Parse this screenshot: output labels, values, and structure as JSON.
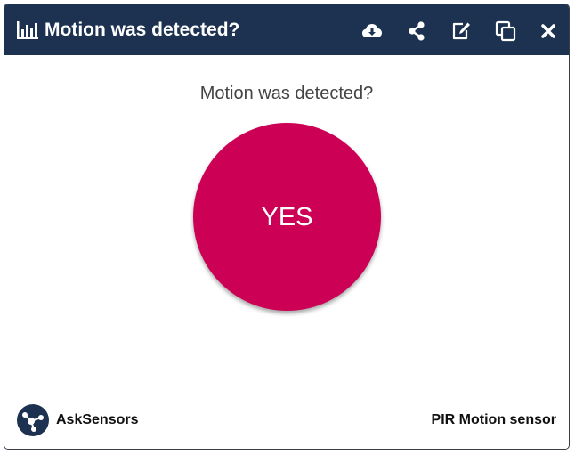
{
  "widget": {
    "title": "Motion was detected?",
    "question": "Motion was detected?",
    "state_text": "YES",
    "state_color": "#cc0055",
    "header_color": "#1c3250"
  },
  "toolbar": {
    "icons": [
      "cloud-download-icon",
      "share-icon",
      "edit-icon",
      "copy-icon",
      "close-icon"
    ]
  },
  "footer": {
    "brand_name": "AskSensors",
    "brand_icon": "asksensors-logo-icon",
    "sensor_name": "PIR Motion sensor"
  }
}
